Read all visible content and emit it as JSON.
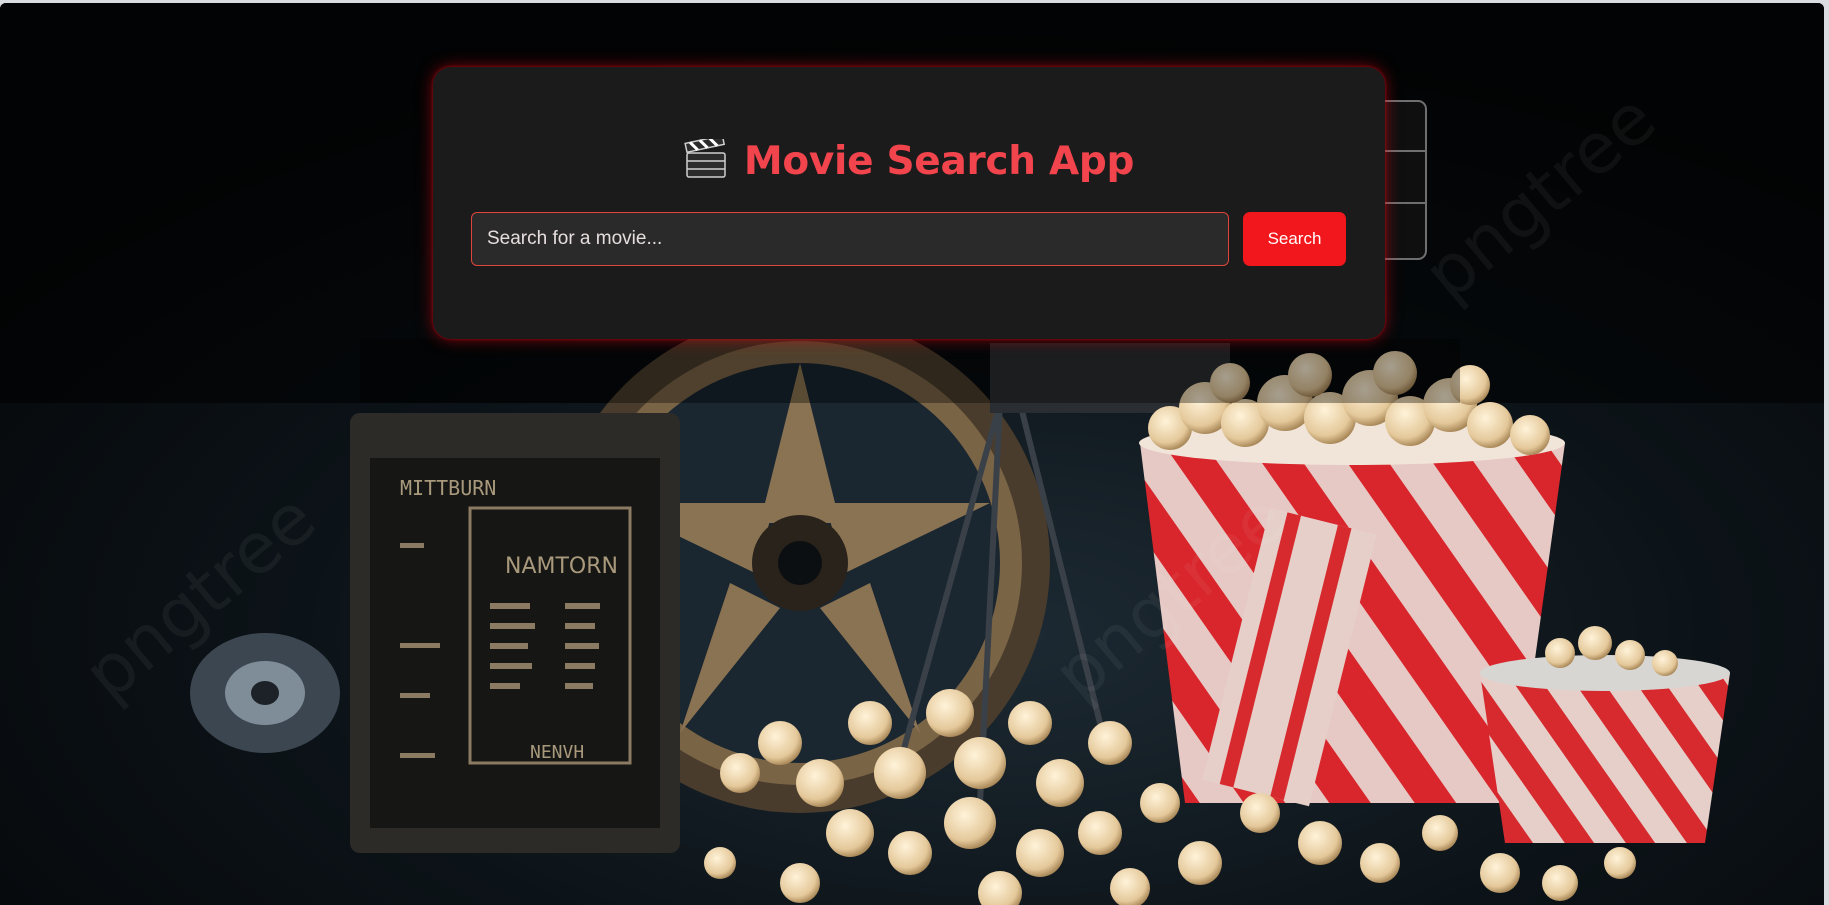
{
  "app": {
    "title": "Movie Search App",
    "title_icon": "clapperboard-icon"
  },
  "search": {
    "placeholder": "Search for a movie...",
    "value": "",
    "button_label": "Search"
  },
  "background": {
    "description_icon": "cinema-popcorn-film-reel-background",
    "watermark": "pngtree"
  },
  "colors": {
    "accent": "#f2444c",
    "button": "#f2171c",
    "card": "#1b1b1b",
    "input_bg": "#2a2a2a",
    "page_bg": "#07090c"
  }
}
